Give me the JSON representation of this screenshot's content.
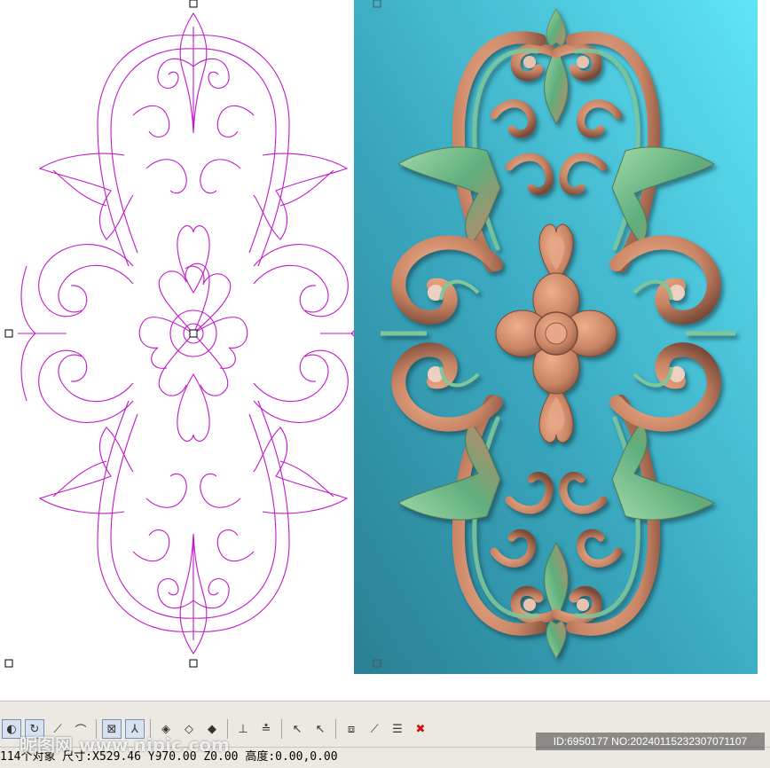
{
  "status_bar": {
    "text": "114个对象 尺寸:X529.46 Y970.00 Z0.00 高度:0.00,0.00"
  },
  "watermark": {
    "left": "昵图网 www.nipic.com",
    "right": "ID:6950177 NO:20240115232307071107"
  },
  "colors": {
    "wireframe": "#c018c8",
    "relief_bg_top": "#5fe4f6",
    "relief_bg_bottom": "#2a7f93",
    "relief_copper": "#c88464",
    "relief_green": "#5fae7c"
  },
  "toolbar": {
    "icons": [
      "view-icon",
      "rotate-icon",
      "line-icon",
      "curve-icon",
      "snap-grid-icon",
      "axis-icon",
      "node-edit-icon",
      "node-add-icon",
      "node-delete-icon",
      "align-left-icon",
      "align-right-icon",
      "select-arrow-icon",
      "deselect-arrow-icon",
      "transform-icon",
      "measure-icon",
      "layer-icon",
      "close-icon"
    ]
  }
}
